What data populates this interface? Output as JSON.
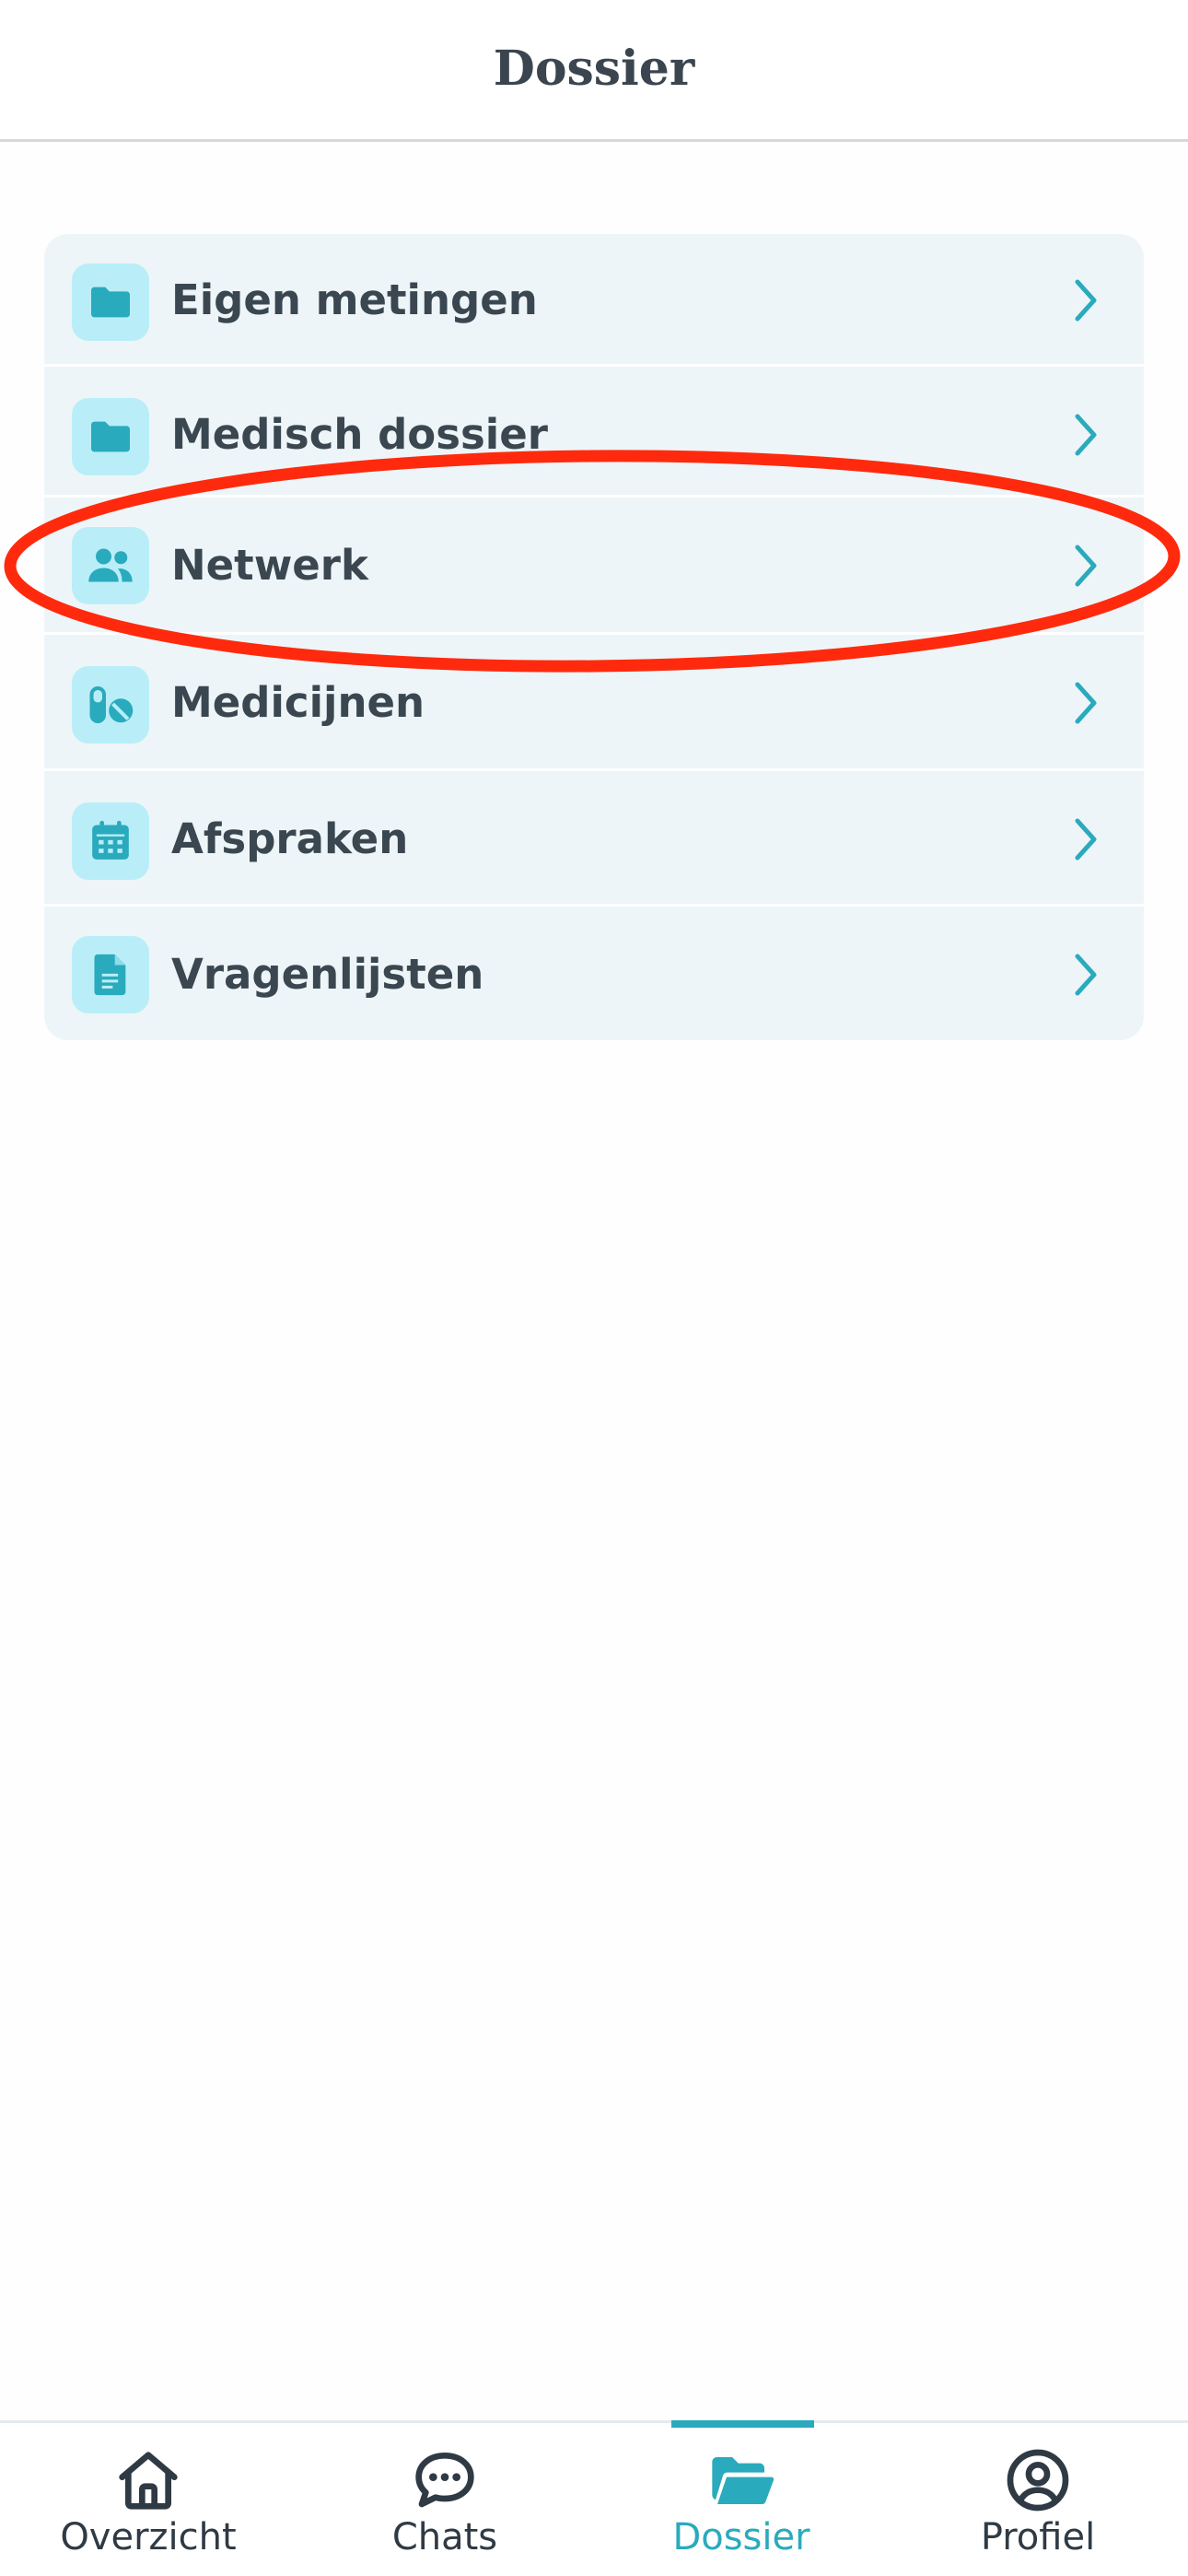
{
  "header": {
    "title": "Dossier"
  },
  "menu": {
    "items": [
      {
        "label": "Eigen metingen",
        "icon": "folder-icon"
      },
      {
        "label": "Medisch dossier",
        "icon": "folder-icon"
      },
      {
        "label": "Netwerk",
        "icon": "people-icon"
      },
      {
        "label": "Medicijnen",
        "icon": "pills-icon"
      },
      {
        "label": "Afspraken",
        "icon": "calendar-icon"
      },
      {
        "label": "Vragenlijsten",
        "icon": "document-icon"
      }
    ]
  },
  "annotation": {
    "highlighted_item": "Netwerk",
    "ring_color": "#ff2a0d"
  },
  "tabbar": {
    "tabs": [
      {
        "label": "Overzicht",
        "icon": "home-icon",
        "active": false
      },
      {
        "label": "Chats",
        "icon": "chat-icon",
        "active": false
      },
      {
        "label": "Dossier",
        "icon": "folder-open-icon",
        "active": true
      },
      {
        "label": "Profiel",
        "icon": "profile-icon",
        "active": false
      }
    ]
  },
  "colors": {
    "accent": "#2aaabd",
    "icon_bg": "#b9eef8",
    "card_bg": "#eef5f8",
    "text": "#3a4750"
  }
}
